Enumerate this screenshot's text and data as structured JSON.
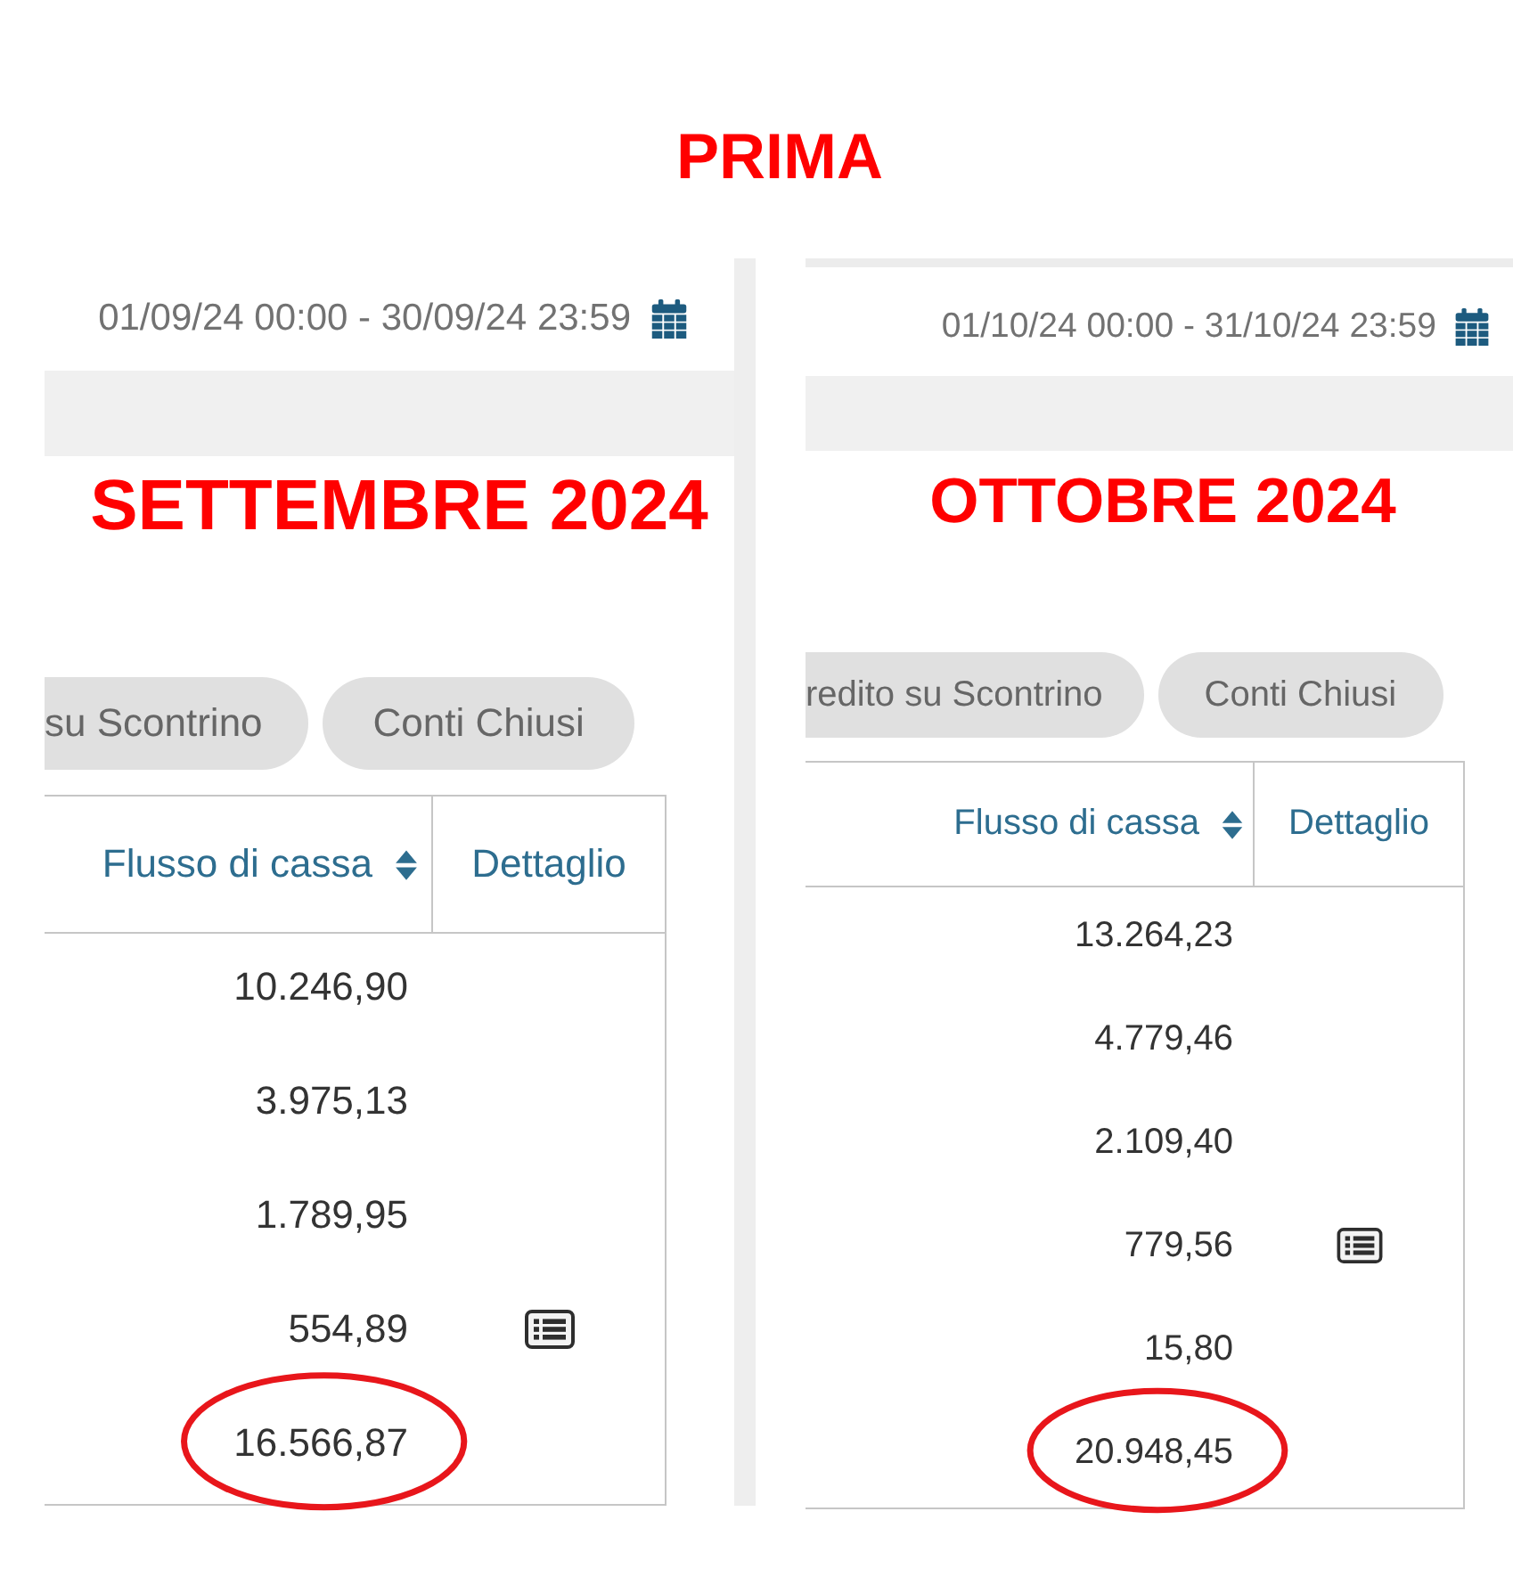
{
  "title": "PRIMA",
  "panels": [
    {
      "date_range": "01/09/24 00:00 - 30/09/24 23:59",
      "month_label": "SETTEMBRE 2024",
      "filter_buttons": [
        "su Scontrino",
        "Conti Chiusi"
      ],
      "table": {
        "columns": [
          {
            "label": "Flusso di cassa",
            "sortable": true
          },
          {
            "label": "Dettaglio",
            "sortable": false
          }
        ],
        "rows": [
          {
            "value": "10.246,90",
            "has_detail": false,
            "circled": false
          },
          {
            "value": "3.975,13",
            "has_detail": false,
            "circled": false
          },
          {
            "value": "1.789,95",
            "has_detail": false,
            "circled": false
          },
          {
            "value": "554,89",
            "has_detail": true,
            "circled": false
          },
          {
            "value": "16.566,87",
            "has_detail": false,
            "circled": true
          }
        ]
      }
    },
    {
      "date_range": "01/10/24 00:00 - 31/10/24 23:59",
      "month_label": "OTTOBRE 2024",
      "filter_buttons": [
        "redito su Scontrino",
        "Conti Chiusi"
      ],
      "table": {
        "columns": [
          {
            "label": "Flusso di cassa",
            "sortable": true
          },
          {
            "label": "Dettaglio",
            "sortable": false
          }
        ],
        "rows": [
          {
            "value": "13.264,23",
            "has_detail": false,
            "circled": false
          },
          {
            "value": "4.779,46",
            "has_detail": false,
            "circled": false
          },
          {
            "value": "2.109,40",
            "has_detail": false,
            "circled": false
          },
          {
            "value": "779,56",
            "has_detail": true,
            "circled": false
          },
          {
            "value": "15,80",
            "has_detail": false,
            "circled": false
          },
          {
            "value": "20.948,45",
            "has_detail": false,
            "circled": true
          }
        ]
      }
    }
  ]
}
